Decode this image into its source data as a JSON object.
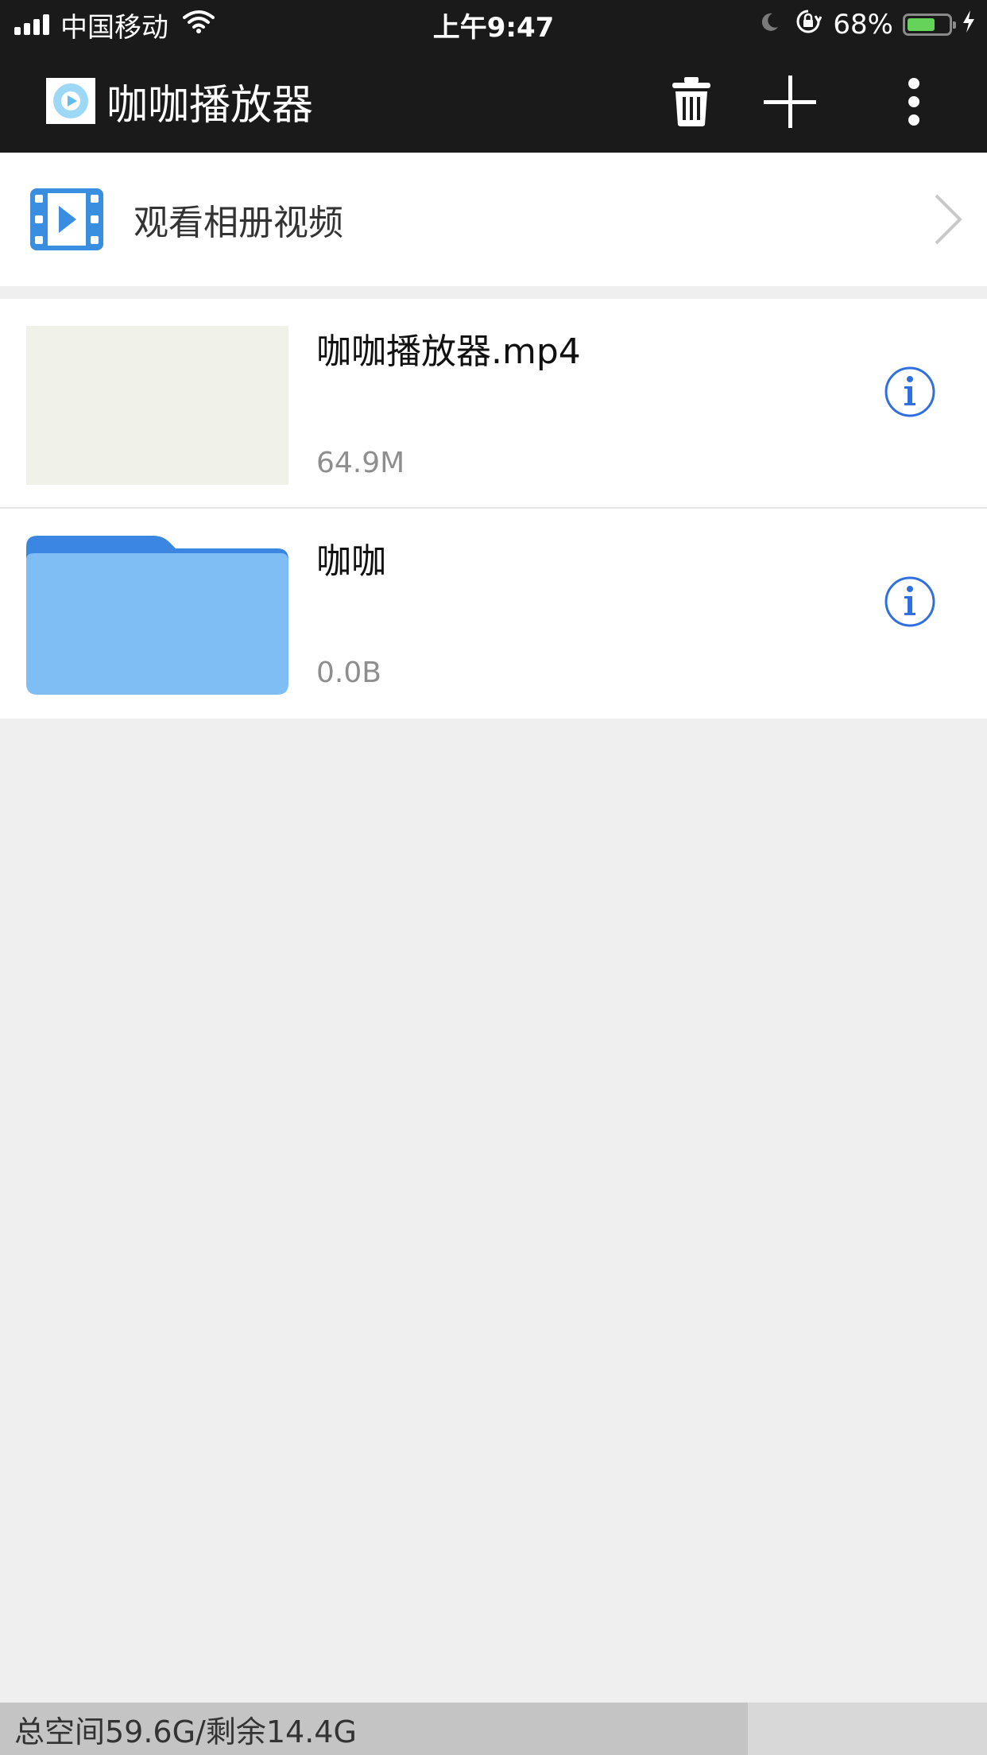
{
  "status_bar": {
    "carrier": "中国移动",
    "time": "上午9:47",
    "battery_percent": "68%",
    "battery_level": 0.68,
    "icons": [
      "signal-icon",
      "wifi-icon",
      "moon-icon",
      "orientation-lock-icon",
      "battery-icon",
      "charging-icon"
    ]
  },
  "nav_bar": {
    "title": "咖咖播放器",
    "actions": [
      "trash-icon",
      "plus-icon",
      "more-vertical-icon"
    ]
  },
  "album": {
    "label": "观看相册视频",
    "icon": "film-icon"
  },
  "files": [
    {
      "name": "咖咖播放器.mp4",
      "size": "64.9M",
      "kind": "video"
    },
    {
      "name": "咖咖",
      "size": "0.0B",
      "kind": "folder"
    }
  ],
  "footer": {
    "storage_text": "总空间59.6G/剩余14.4G",
    "used_fraction": 0.758
  },
  "colors": {
    "bar_bg": "#1a1a1a",
    "accent_blue": "#2f6fe0",
    "folder_blue": "#7fbdf5",
    "folder_tab": "#3a86e0",
    "film_blue": "#3a8ee0",
    "battery_green": "#65d35a",
    "page_bg": "#efefef"
  }
}
